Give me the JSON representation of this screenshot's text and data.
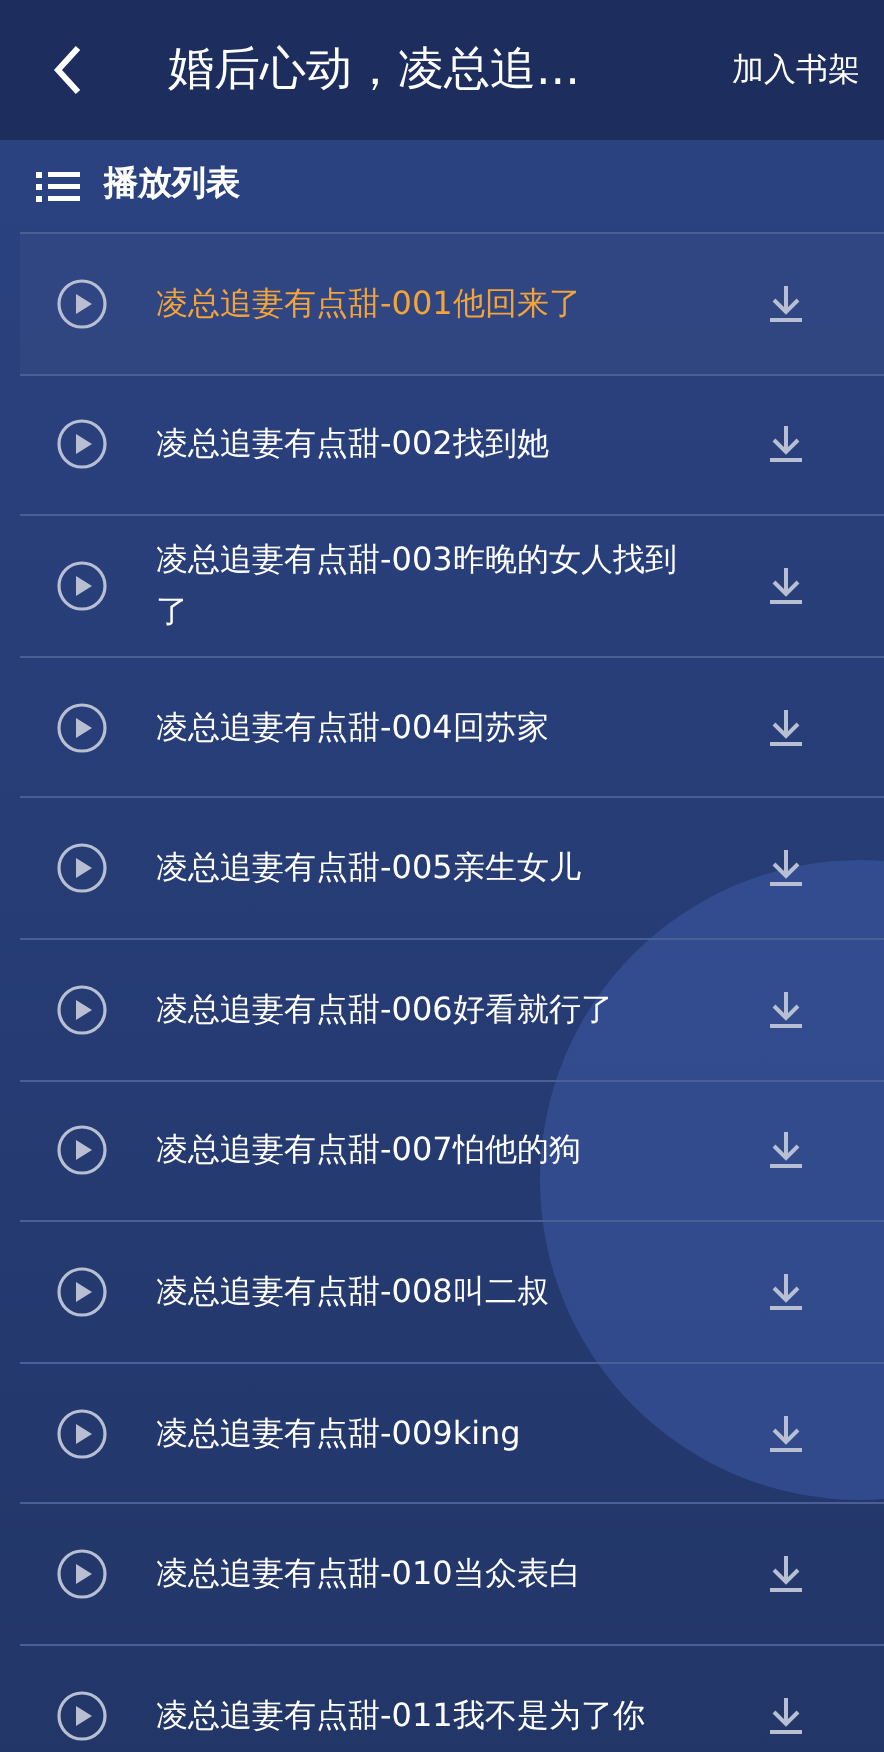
{
  "header": {
    "title": "婚后心动，凌总追...",
    "action": "加入书架"
  },
  "playlist": {
    "title": "播放列表",
    "items": [
      {
        "title": "凌总追妻有点甜-001他回来了",
        "selected": true
      },
      {
        "title": "凌总追妻有点甜-002找到她",
        "selected": false
      },
      {
        "title": "凌总追妻有点甜-003昨晚的女人找到了",
        "selected": false
      },
      {
        "title": "凌总追妻有点甜-004回苏家",
        "selected": false
      },
      {
        "title": "凌总追妻有点甜-005亲生女儿",
        "selected": false
      },
      {
        "title": "凌总追妻有点甜-006好看就行了",
        "selected": false
      },
      {
        "title": "凌总追妻有点甜-007怕他的狗",
        "selected": false
      },
      {
        "title": "凌总追妻有点甜-008叫二叔",
        "selected": false
      },
      {
        "title": "凌总追妻有点甜-009king",
        "selected": false
      },
      {
        "title": "凌总追妻有点甜-010当众表白",
        "selected": false
      },
      {
        "title": "凌总追妻有点甜-011我不是为了你",
        "selected": false
      }
    ]
  }
}
